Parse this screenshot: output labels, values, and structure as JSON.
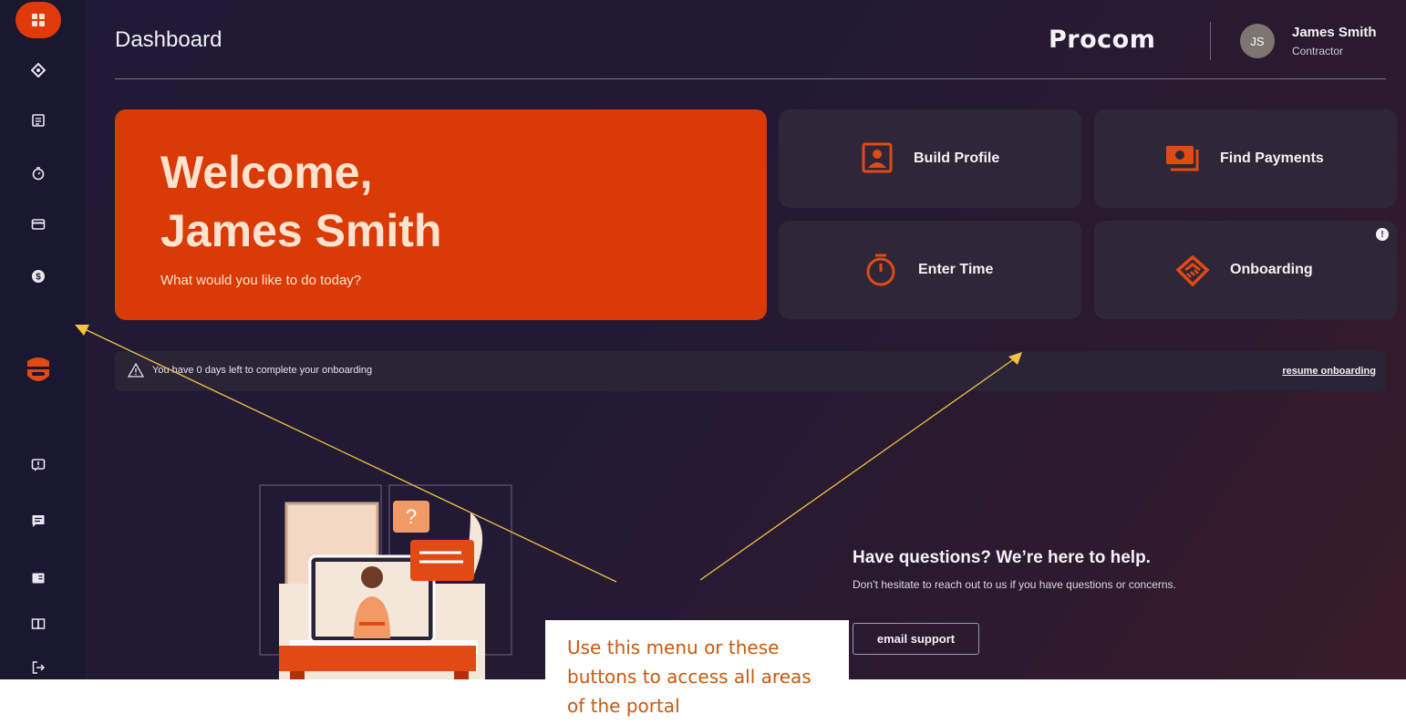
{
  "header": {
    "title": "Dashboard",
    "brand": "Procom",
    "user": {
      "initials": "JS",
      "name": "James Smith",
      "role": "Contractor"
    }
  },
  "sidebar": {
    "items": [
      {
        "name": "dashboard",
        "icon": "grid-icon"
      },
      {
        "name": "tags",
        "icon": "tag-icon"
      },
      {
        "name": "timesheets",
        "icon": "list-icon"
      },
      {
        "name": "time",
        "icon": "stopwatch-icon"
      },
      {
        "name": "payments",
        "icon": "card-icon"
      },
      {
        "name": "earnings",
        "icon": "dollar-icon"
      },
      {
        "name": "feedback",
        "icon": "alert-message-icon"
      },
      {
        "name": "chat",
        "icon": "chat-icon"
      },
      {
        "name": "documents",
        "icon": "document-icon"
      },
      {
        "name": "guide",
        "icon": "book-icon"
      },
      {
        "name": "logout",
        "icon": "logout-icon"
      }
    ]
  },
  "welcome": {
    "line1": "Welcome,",
    "line2": "James Smith",
    "subtitle": "What would you like to do today?"
  },
  "tiles": [
    {
      "label": "Build Profile",
      "icon": "profile-icon"
    },
    {
      "label": "Find Payments",
      "icon": "payment-icon"
    },
    {
      "label": "Enter Time",
      "icon": "stopwatch-icon"
    },
    {
      "label": "Onboarding",
      "icon": "handshake-icon",
      "badge": "!"
    }
  ],
  "alert": {
    "text": "You have 0 days left to complete your onboarding",
    "action": "resume onboarding"
  },
  "help": {
    "title": "Have questions? We’re here to help.",
    "subtitle": "Don’t hesitate to reach out to us if you have questions or concerns.",
    "button": "email support"
  },
  "annotation": {
    "text": "Use this menu or these buttons to access all areas of the portal",
    "colors": {
      "text": "#c55a11",
      "arrow": "#f5c242"
    }
  },
  "colors": {
    "accent": "#d93a06",
    "background": "#221a34",
    "tile": "#2f2738"
  }
}
